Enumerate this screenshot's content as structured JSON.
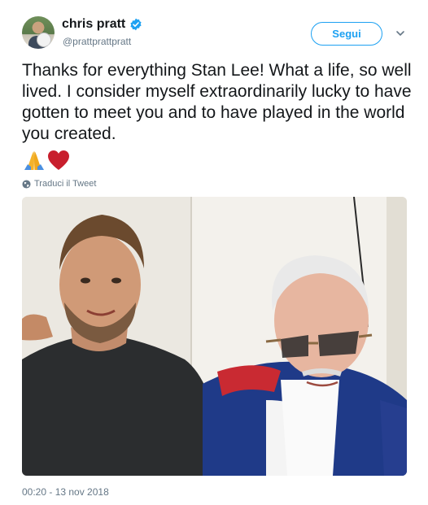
{
  "user": {
    "display_name": "chris pratt",
    "handle": "@prattprattpratt",
    "verified": true
  },
  "follow_button_label": "Segui",
  "tweet": {
    "text": "Thanks for everything Stan Lee! What a life, so well lived. I consider myself extraordinarily lucky to have gotten to meet you and to have played in the world you created.",
    "emojis": [
      "folded-hands-icon",
      "red-heart-icon"
    ],
    "translate_label": "Traduci il Tweet",
    "timestamp": "00:20 - 13 nov 2018"
  },
  "colors": {
    "accent": "#1da1f2",
    "text": "#14171a",
    "secondary_text": "#657786"
  }
}
